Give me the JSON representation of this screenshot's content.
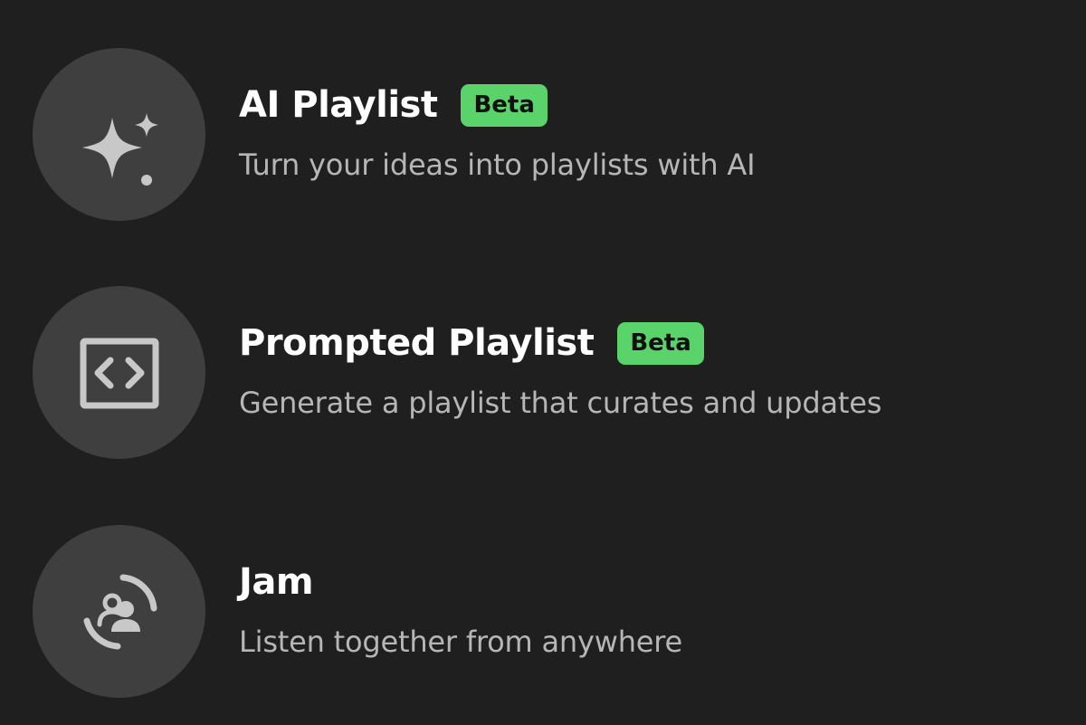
{
  "items": [
    {
      "title": "AI Playlist",
      "badge": "Beta",
      "description": "Turn your ideas into playlists with AI",
      "icon": "sparkle-icon"
    },
    {
      "title": "Prompted Playlist",
      "badge": "Beta",
      "description": "Generate a playlist that curates and updates",
      "icon": "code-brackets-icon"
    },
    {
      "title": "Jam",
      "description": "Listen together from anywhere",
      "icon": "jam-people-icon"
    }
  ],
  "colors": {
    "background": "#1f1f1f",
    "icon_circle": "#3f3f3f",
    "icon_glyph": "#c8c8c8",
    "badge_bg": "#5ad36b",
    "badge_text": "#101010",
    "title": "#ffffff",
    "description": "#b6b6b6"
  }
}
